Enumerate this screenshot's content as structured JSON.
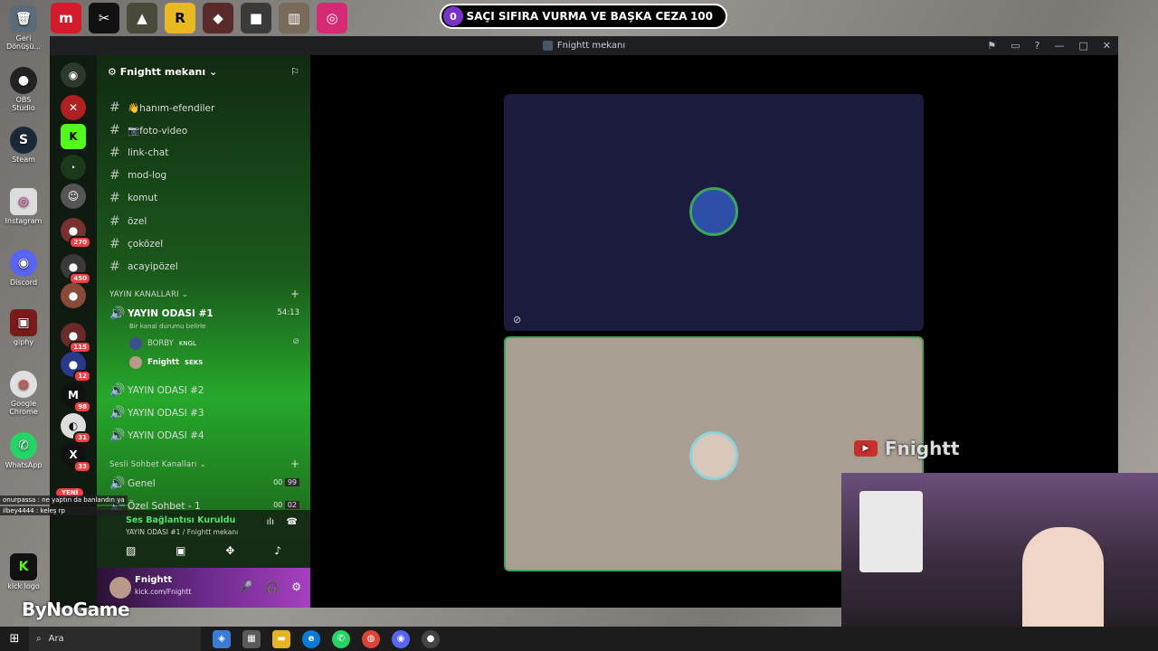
{
  "desktop": {
    "icons": [
      {
        "label": "Geri Dönüşü...",
        "glyph": "🗑",
        "color": "#5a6b7a"
      },
      {
        "label": "OBS Studio",
        "glyph": "●",
        "color": "#222222"
      },
      {
        "label": "Steam",
        "glyph": "S",
        "color": "#1b2838"
      },
      {
        "label": "Instagram",
        "glyph": "◎",
        "color": "#e6e6e6"
      },
      {
        "label": "Discord",
        "glyph": "◉",
        "color": "#5865f2"
      },
      {
        "label": "giphy",
        "glyph": "▣",
        "color": "#7a1a1a"
      },
      {
        "label": "Google Chrome",
        "glyph": "◍",
        "color": "#e0e0e0"
      },
      {
        "label": "WhatsApp",
        "glyph": "✆",
        "color": "#25d366"
      },
      {
        "label": "kick logo",
        "glyph": "K",
        "color": "#53fc18"
      }
    ],
    "chat_overlay": [
      "onurpassa : ne yaptın da banlandın ya",
      "ilbey4444 : keleş rp"
    ],
    "yeni_badge": "YENİ",
    "sponsor": "ByNoGame",
    "youtube_name": "Fnightt"
  },
  "prediction": {
    "left_value": "0",
    "title": "SAÇI SIFIRA VURMA VE BAŞKA CEZA",
    "right_value": "100"
  },
  "window": {
    "title": "Fnightt mekanı"
  },
  "server": {
    "name": "Fnightt mekanı"
  },
  "channels": {
    "text": [
      "👋hanım-efendiler",
      "📷foto-video",
      "link-chat",
      "mod-log",
      "komut",
      "özel",
      "çoközel",
      "acayipözel"
    ],
    "stream_category": "YAYIN KANALLARI",
    "active_voice": {
      "name": "YAYIN ODASI #1",
      "time": "54:13",
      "status_hint": "Bir kanal durumu belirle"
    },
    "voice_users": [
      {
        "name": "BORBY",
        "tag": "KNGL"
      },
      {
        "name": "Fnightt",
        "tag": "SEKS"
      }
    ],
    "other_voice": [
      "YAYIN ODASI #2",
      "YAYIN ODASI #3",
      "YAYIN ODASI #4"
    ],
    "chat_category": "Sesli Sohbet Kanalları",
    "genel": {
      "name": "Genel",
      "count_a": "00",
      "count_b": "99"
    },
    "ozel_sohbet": {
      "name": "Özel Sohbet - 1",
      "count_a": "00",
      "count_b": "02"
    }
  },
  "guild_badges": [
    "270",
    "450",
    "115",
    "12",
    "98",
    "31",
    "33"
  ],
  "voice_connection": {
    "status": "Ses Bağlantısı Kuruldu",
    "location": "YAYIN ODASI #1 / Fnightt mekanı"
  },
  "user": {
    "name": "Fnightt",
    "status": "kick.com/Fnightt"
  },
  "taskbar": {
    "search_placeholder": "Ara"
  }
}
